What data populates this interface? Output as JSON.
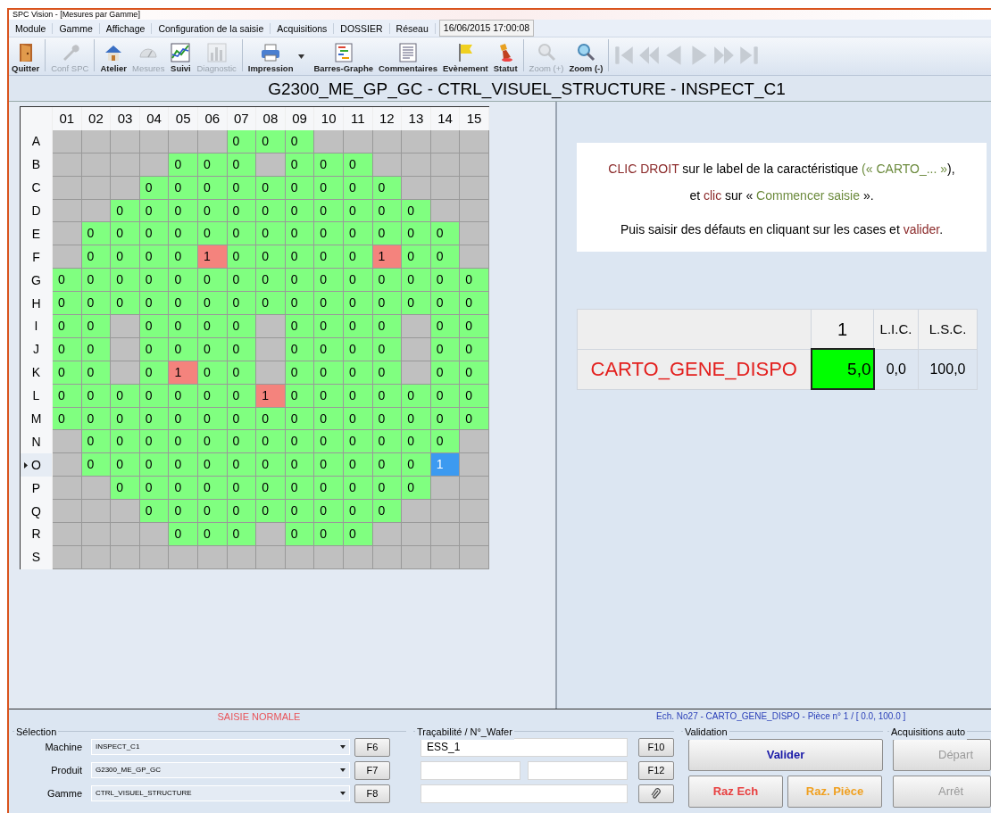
{
  "window": {
    "title": "SPC Vision - [Mesures par Gamme]"
  },
  "menu": {
    "items": [
      "Module",
      "Gamme",
      "Affichage",
      "Configuration de la saisie",
      "Acquisitions",
      "DOSSIER",
      "Réseau"
    ],
    "datetime": "16/06/2015 17:00:08"
  },
  "toolbar": {
    "buttons": [
      {
        "kind": "exit",
        "label": "Quitter",
        "disabled": false,
        "has_menu": false
      },
      {
        "kind": "settings",
        "label": "Conf SPC",
        "disabled": true,
        "has_menu": false
      },
      {
        "kind": "workshop",
        "label": "Atelier",
        "disabled": false,
        "has_menu": false
      },
      {
        "kind": "gauge",
        "label": "Mesures",
        "disabled": true,
        "has_menu": false
      },
      {
        "kind": "trend",
        "label": "Suivi",
        "disabled": false,
        "has_menu": false
      },
      {
        "kind": "histogram",
        "label": "Diagnostic",
        "disabled": true,
        "has_menu": false
      },
      {
        "kind": "print",
        "label": "Impression",
        "disabled": false,
        "has_menu": true
      },
      {
        "kind": "gantt",
        "label": "Barres-Graphe",
        "disabled": false,
        "has_menu": false
      },
      {
        "kind": "notes",
        "label": "Commentaires",
        "disabled": false,
        "has_menu": false
      },
      {
        "kind": "flag",
        "label": "Evènement",
        "disabled": false,
        "has_menu": false
      },
      {
        "kind": "stamp",
        "label": "Statut",
        "disabled": false,
        "has_menu": false
      },
      {
        "kind": "zoom_in",
        "label": "Zoom (+)",
        "disabled": true,
        "has_menu": false
      },
      {
        "kind": "zoom_out",
        "label": "Zoom (-)",
        "disabled": false,
        "has_menu": false
      }
    ],
    "nav": [
      {
        "kind": "first",
        "disabled": true
      },
      {
        "kind": "fast_back",
        "disabled": true
      },
      {
        "kind": "back",
        "disabled": true
      },
      {
        "kind": "forward",
        "disabled": true
      },
      {
        "kind": "fast_forward",
        "disabled": true
      },
      {
        "kind": "last",
        "disabled": true
      }
    ]
  },
  "header": {
    "title": "G2300_ME_GP_GC - CTRL_VISUEL_STRUCTURE - INSPECT_C1"
  },
  "wafer_map": {
    "columns": [
      "01",
      "02",
      "03",
      "04",
      "05",
      "06",
      "07",
      "08",
      "09",
      "10",
      "11",
      "12",
      "13",
      "14",
      "15"
    ],
    "rows": [
      {
        "label": "A",
        "current": false,
        "cells": [
          {
            "kind": "blank",
            "selected": false
          },
          {
            "kind": "blank",
            "selected": false
          },
          {
            "kind": "blank",
            "selected": false
          },
          {
            "kind": "blank",
            "selected": false
          },
          {
            "kind": "blank",
            "selected": false
          },
          {
            "kind": "blank",
            "selected": false
          },
          {
            "value": "0",
            "kind": "pass",
            "selected": false
          },
          {
            "value": "0",
            "kind": "pass",
            "selected": false
          },
          {
            "value": "0",
            "kind": "pass",
            "selected": false
          },
          {
            "kind": "blank",
            "selected": false
          },
          {
            "kind": "blank",
            "selected": false
          },
          {
            "kind": "blank",
            "selected": false
          },
          {
            "kind": "blank",
            "selected": false
          },
          {
            "kind": "blank",
            "selected": false
          },
          {
            "kind": "blank",
            "selected": false
          }
        ]
      },
      {
        "label": "B",
        "current": false,
        "cells": [
          {
            "kind": "blank",
            "selected": false
          },
          {
            "kind": "blank",
            "selected": false
          },
          {
            "kind": "blank",
            "selected": false
          },
          {
            "kind": "blank",
            "selected": false
          },
          {
            "value": "0",
            "kind": "pass",
            "selected": false
          },
          {
            "value": "0",
            "kind": "pass",
            "selected": false
          },
          {
            "value": "0",
            "kind": "pass",
            "selected": false
          },
          {
            "kind": "blank",
            "selected": false
          },
          {
            "value": "0",
            "kind": "pass",
            "selected": false
          },
          {
            "value": "0",
            "kind": "pass",
            "selected": false
          },
          {
            "value": "0",
            "kind": "pass",
            "selected": false
          },
          {
            "kind": "blank",
            "selected": false
          },
          {
            "kind": "blank",
            "selected": false
          },
          {
            "kind": "blank",
            "selected": false
          },
          {
            "kind": "blank",
            "selected": false
          }
        ]
      },
      {
        "label": "C",
        "current": false,
        "cells": [
          {
            "kind": "blank",
            "selected": false
          },
          {
            "kind": "blank",
            "selected": false
          },
          {
            "kind": "blank",
            "selected": false
          },
          {
            "value": "0",
            "kind": "pass",
            "selected": false
          },
          {
            "value": "0",
            "kind": "pass",
            "selected": false
          },
          {
            "value": "0",
            "kind": "pass",
            "selected": false
          },
          {
            "value": "0",
            "kind": "pass",
            "selected": false
          },
          {
            "value": "0",
            "kind": "pass",
            "selected": false
          },
          {
            "value": "0",
            "kind": "pass",
            "selected": false
          },
          {
            "value": "0",
            "kind": "pass",
            "selected": false
          },
          {
            "value": "0",
            "kind": "pass",
            "selected": false
          },
          {
            "value": "0",
            "kind": "pass",
            "selected": false
          },
          {
            "kind": "blank",
            "selected": false
          },
          {
            "kind": "blank",
            "selected": false
          },
          {
            "kind": "blank",
            "selected": false
          }
        ]
      },
      {
        "label": "D",
        "current": false,
        "cells": [
          {
            "kind": "blank",
            "selected": false
          },
          {
            "kind": "blank",
            "selected": false
          },
          {
            "value": "0",
            "kind": "pass",
            "selected": false
          },
          {
            "value": "0",
            "kind": "pass",
            "selected": false
          },
          {
            "value": "0",
            "kind": "pass",
            "selected": false
          },
          {
            "value": "0",
            "kind": "pass",
            "selected": false
          },
          {
            "value": "0",
            "kind": "pass",
            "selected": false
          },
          {
            "value": "0",
            "kind": "pass",
            "selected": false
          },
          {
            "value": "0",
            "kind": "pass",
            "selected": false
          },
          {
            "value": "0",
            "kind": "pass",
            "selected": false
          },
          {
            "value": "0",
            "kind": "pass",
            "selected": false
          },
          {
            "value": "0",
            "kind": "pass",
            "selected": false
          },
          {
            "value": "0",
            "kind": "pass",
            "selected": false
          },
          {
            "kind": "blank",
            "selected": false
          },
          {
            "kind": "blank",
            "selected": false
          }
        ]
      },
      {
        "label": "E",
        "current": false,
        "cells": [
          {
            "kind": "blank",
            "selected": false
          },
          {
            "value": "0",
            "kind": "pass",
            "selected": false
          },
          {
            "value": "0",
            "kind": "pass",
            "selected": false
          },
          {
            "value": "0",
            "kind": "pass",
            "selected": false
          },
          {
            "value": "0",
            "kind": "pass",
            "selected": false
          },
          {
            "value": "0",
            "kind": "pass",
            "selected": false
          },
          {
            "value": "0",
            "kind": "pass",
            "selected": false
          },
          {
            "value": "0",
            "kind": "pass",
            "selected": false
          },
          {
            "value": "0",
            "kind": "pass",
            "selected": false
          },
          {
            "value": "0",
            "kind": "pass",
            "selected": false
          },
          {
            "value": "0",
            "kind": "pass",
            "selected": false
          },
          {
            "value": "0",
            "kind": "pass",
            "selected": false
          },
          {
            "value": "0",
            "kind": "pass",
            "selected": false
          },
          {
            "value": "0",
            "kind": "pass",
            "selected": false
          },
          {
            "kind": "blank",
            "selected": false
          }
        ]
      },
      {
        "label": "F",
        "current": false,
        "cells": [
          {
            "kind": "blank",
            "selected": false
          },
          {
            "value": "0",
            "kind": "pass",
            "selected": false
          },
          {
            "value": "0",
            "kind": "pass",
            "selected": false
          },
          {
            "value": "0",
            "kind": "pass",
            "selected": false
          },
          {
            "value": "0",
            "kind": "pass",
            "selected": false
          },
          {
            "value": "1",
            "kind": "fail",
            "selected": false
          },
          {
            "value": "0",
            "kind": "pass",
            "selected": false
          },
          {
            "value": "0",
            "kind": "pass",
            "selected": false
          },
          {
            "value": "0",
            "kind": "pass",
            "selected": false
          },
          {
            "value": "0",
            "kind": "pass",
            "selected": false
          },
          {
            "value": "0",
            "kind": "pass",
            "selected": false
          },
          {
            "value": "1",
            "kind": "fail",
            "selected": false
          },
          {
            "value": "0",
            "kind": "pass",
            "selected": false
          },
          {
            "value": "0",
            "kind": "pass",
            "selected": false
          },
          {
            "kind": "blank",
            "selected": false
          }
        ]
      },
      {
        "label": "G",
        "current": false,
        "cells": [
          {
            "value": "0",
            "kind": "pass",
            "selected": false
          },
          {
            "value": "0",
            "kind": "pass",
            "selected": false
          },
          {
            "value": "0",
            "kind": "pass",
            "selected": false
          },
          {
            "value": "0",
            "kind": "pass",
            "selected": false
          },
          {
            "value": "0",
            "kind": "pass",
            "selected": false
          },
          {
            "value": "0",
            "kind": "pass",
            "selected": false
          },
          {
            "value": "0",
            "kind": "pass",
            "selected": false
          },
          {
            "value": "0",
            "kind": "pass",
            "selected": false
          },
          {
            "value": "0",
            "kind": "pass",
            "selected": false
          },
          {
            "value": "0",
            "kind": "pass",
            "selected": false
          },
          {
            "value": "0",
            "kind": "pass",
            "selected": false
          },
          {
            "value": "0",
            "kind": "pass",
            "selected": false
          },
          {
            "value": "0",
            "kind": "pass",
            "selected": false
          },
          {
            "value": "0",
            "kind": "pass",
            "selected": false
          },
          {
            "value": "0",
            "kind": "pass",
            "selected": false
          }
        ]
      },
      {
        "label": "H",
        "current": false,
        "cells": [
          {
            "value": "0",
            "kind": "pass",
            "selected": false
          },
          {
            "value": "0",
            "kind": "pass",
            "selected": false
          },
          {
            "value": "0",
            "kind": "pass",
            "selected": false
          },
          {
            "value": "0",
            "kind": "pass",
            "selected": false
          },
          {
            "value": "0",
            "kind": "pass",
            "selected": false
          },
          {
            "value": "0",
            "kind": "pass",
            "selected": false
          },
          {
            "value": "0",
            "kind": "pass",
            "selected": false
          },
          {
            "value": "0",
            "kind": "pass",
            "selected": false
          },
          {
            "value": "0",
            "kind": "pass",
            "selected": false
          },
          {
            "value": "0",
            "kind": "pass",
            "selected": false
          },
          {
            "value": "0",
            "kind": "pass",
            "selected": false
          },
          {
            "value": "0",
            "kind": "pass",
            "selected": false
          },
          {
            "value": "0",
            "kind": "pass",
            "selected": false
          },
          {
            "value": "0",
            "kind": "pass",
            "selected": false
          },
          {
            "value": "0",
            "kind": "pass",
            "selected": false
          }
        ]
      },
      {
        "label": "I",
        "current": false,
        "cells": [
          {
            "value": "0",
            "kind": "pass",
            "selected": false
          },
          {
            "value": "0",
            "kind": "pass",
            "selected": false
          },
          {
            "kind": "blank",
            "selected": false
          },
          {
            "value": "0",
            "kind": "pass",
            "selected": false
          },
          {
            "value": "0",
            "kind": "pass",
            "selected": false
          },
          {
            "value": "0",
            "kind": "pass",
            "selected": false
          },
          {
            "value": "0",
            "kind": "pass",
            "selected": false
          },
          {
            "kind": "blank",
            "selected": false
          },
          {
            "value": "0",
            "kind": "pass",
            "selected": false
          },
          {
            "value": "0",
            "kind": "pass",
            "selected": false
          },
          {
            "value": "0",
            "kind": "pass",
            "selected": false
          },
          {
            "value": "0",
            "kind": "pass",
            "selected": false
          },
          {
            "kind": "blank",
            "selected": false
          },
          {
            "value": "0",
            "kind": "pass",
            "selected": false
          },
          {
            "value": "0",
            "kind": "pass",
            "selected": false
          }
        ]
      },
      {
        "label": "J",
        "current": false,
        "cells": [
          {
            "value": "0",
            "kind": "pass",
            "selected": false
          },
          {
            "value": "0",
            "kind": "pass",
            "selected": false
          },
          {
            "kind": "blank",
            "selected": false
          },
          {
            "value": "0",
            "kind": "pass",
            "selected": false
          },
          {
            "value": "0",
            "kind": "pass",
            "selected": false
          },
          {
            "value": "0",
            "kind": "pass",
            "selected": false
          },
          {
            "value": "0",
            "kind": "pass",
            "selected": false
          },
          {
            "kind": "blank",
            "selected": false
          },
          {
            "value": "0",
            "kind": "pass",
            "selected": false
          },
          {
            "value": "0",
            "kind": "pass",
            "selected": false
          },
          {
            "value": "0",
            "kind": "pass",
            "selected": false
          },
          {
            "value": "0",
            "kind": "pass",
            "selected": false
          },
          {
            "kind": "blank",
            "selected": false
          },
          {
            "value": "0",
            "kind": "pass",
            "selected": false
          },
          {
            "value": "0",
            "kind": "pass",
            "selected": false
          }
        ]
      },
      {
        "label": "K",
        "current": false,
        "cells": [
          {
            "value": "0",
            "kind": "pass",
            "selected": false
          },
          {
            "value": "0",
            "kind": "pass",
            "selected": false
          },
          {
            "kind": "blank",
            "selected": false
          },
          {
            "value": "0",
            "kind": "pass",
            "selected": false
          },
          {
            "value": "1",
            "kind": "fail",
            "selected": false
          },
          {
            "value": "0",
            "kind": "pass",
            "selected": false
          },
          {
            "value": "0",
            "kind": "pass",
            "selected": false
          },
          {
            "kind": "blank",
            "selected": false
          },
          {
            "value": "0",
            "kind": "pass",
            "selected": false
          },
          {
            "value": "0",
            "kind": "pass",
            "selected": false
          },
          {
            "value": "0",
            "kind": "pass",
            "selected": false
          },
          {
            "value": "0",
            "kind": "pass",
            "selected": false
          },
          {
            "kind": "blank",
            "selected": false
          },
          {
            "value": "0",
            "kind": "pass",
            "selected": false
          },
          {
            "value": "0",
            "kind": "pass",
            "selected": false
          }
        ]
      },
      {
        "label": "L",
        "current": false,
        "cells": [
          {
            "value": "0",
            "kind": "pass",
            "selected": false
          },
          {
            "value": "0",
            "kind": "pass",
            "selected": false
          },
          {
            "value": "0",
            "kind": "pass",
            "selected": false
          },
          {
            "value": "0",
            "kind": "pass",
            "selected": false
          },
          {
            "value": "0",
            "kind": "pass",
            "selected": false
          },
          {
            "value": "0",
            "kind": "pass",
            "selected": false
          },
          {
            "value": "0",
            "kind": "pass",
            "selected": false
          },
          {
            "value": "1",
            "kind": "fail",
            "selected": false
          },
          {
            "value": "0",
            "kind": "pass",
            "selected": false
          },
          {
            "value": "0",
            "kind": "pass",
            "selected": false
          },
          {
            "value": "0",
            "kind": "pass",
            "selected": false
          },
          {
            "value": "0",
            "kind": "pass",
            "selected": false
          },
          {
            "value": "0",
            "kind": "pass",
            "selected": false
          },
          {
            "value": "0",
            "kind": "pass",
            "selected": false
          },
          {
            "value": "0",
            "kind": "pass",
            "selected": false
          }
        ]
      },
      {
        "label": "M",
        "current": false,
        "cells": [
          {
            "value": "0",
            "kind": "pass",
            "selected": false
          },
          {
            "value": "0",
            "kind": "pass",
            "selected": false
          },
          {
            "value": "0",
            "kind": "pass",
            "selected": false
          },
          {
            "value": "0",
            "kind": "pass",
            "selected": false
          },
          {
            "value": "0",
            "kind": "pass",
            "selected": false
          },
          {
            "value": "0",
            "kind": "pass",
            "selected": false
          },
          {
            "value": "0",
            "kind": "pass",
            "selected": false
          },
          {
            "value": "0",
            "kind": "pass",
            "selected": false
          },
          {
            "value": "0",
            "kind": "pass",
            "selected": false
          },
          {
            "value": "0",
            "kind": "pass",
            "selected": false
          },
          {
            "value": "0",
            "kind": "pass",
            "selected": false
          },
          {
            "value": "0",
            "kind": "pass",
            "selected": false
          },
          {
            "value": "0",
            "kind": "pass",
            "selected": false
          },
          {
            "value": "0",
            "kind": "pass",
            "selected": false
          },
          {
            "value": "0",
            "kind": "pass",
            "selected": false
          }
        ]
      },
      {
        "label": "N",
        "current": false,
        "cells": [
          {
            "kind": "blank",
            "selected": false
          },
          {
            "value": "0",
            "kind": "pass",
            "selected": false
          },
          {
            "value": "0",
            "kind": "pass",
            "selected": false
          },
          {
            "value": "0",
            "kind": "pass",
            "selected": false
          },
          {
            "value": "0",
            "kind": "pass",
            "selected": false
          },
          {
            "value": "0",
            "kind": "pass",
            "selected": false
          },
          {
            "value": "0",
            "kind": "pass",
            "selected": false
          },
          {
            "value": "0",
            "kind": "pass",
            "selected": false
          },
          {
            "value": "0",
            "kind": "pass",
            "selected": false
          },
          {
            "value": "0",
            "kind": "pass",
            "selected": false
          },
          {
            "value": "0",
            "kind": "pass",
            "selected": false
          },
          {
            "value": "0",
            "kind": "pass",
            "selected": false
          },
          {
            "value": "0",
            "kind": "pass",
            "selected": false
          },
          {
            "value": "0",
            "kind": "pass",
            "selected": false
          },
          {
            "kind": "blank",
            "selected": false
          }
        ]
      },
      {
        "label": "O",
        "current": true,
        "cells": [
          {
            "kind": "blank",
            "selected": false
          },
          {
            "value": "0",
            "kind": "pass",
            "selected": false
          },
          {
            "value": "0",
            "kind": "pass",
            "selected": false
          },
          {
            "value": "0",
            "kind": "pass",
            "selected": false
          },
          {
            "value": "0",
            "kind": "pass",
            "selected": false
          },
          {
            "value": "0",
            "kind": "pass",
            "selected": false
          },
          {
            "value": "0",
            "kind": "pass",
            "selected": false
          },
          {
            "value": "0",
            "kind": "pass",
            "selected": false
          },
          {
            "value": "0",
            "kind": "pass",
            "selected": false
          },
          {
            "value": "0",
            "kind": "pass",
            "selected": false
          },
          {
            "value": "0",
            "kind": "pass",
            "selected": false
          },
          {
            "value": "0",
            "kind": "pass",
            "selected": false
          },
          {
            "value": "0",
            "kind": "pass",
            "selected": false
          },
          {
            "value": "1",
            "kind": "fail",
            "selected": true
          },
          {
            "kind": "blank",
            "selected": false
          }
        ]
      },
      {
        "label": "P",
        "current": false,
        "cells": [
          {
            "kind": "blank",
            "selected": false
          },
          {
            "kind": "blank",
            "selected": false
          },
          {
            "value": "0",
            "kind": "pass",
            "selected": false
          },
          {
            "value": "0",
            "kind": "pass",
            "selected": false
          },
          {
            "value": "0",
            "kind": "pass",
            "selected": false
          },
          {
            "value": "0",
            "kind": "pass",
            "selected": false
          },
          {
            "value": "0",
            "kind": "pass",
            "selected": false
          },
          {
            "value": "0",
            "kind": "pass",
            "selected": false
          },
          {
            "value": "0",
            "kind": "pass",
            "selected": false
          },
          {
            "value": "0",
            "kind": "pass",
            "selected": false
          },
          {
            "value": "0",
            "kind": "pass",
            "selected": false
          },
          {
            "value": "0",
            "kind": "pass",
            "selected": false
          },
          {
            "value": "0",
            "kind": "pass",
            "selected": false
          },
          {
            "kind": "blank",
            "selected": false
          },
          {
            "kind": "blank",
            "selected": false
          }
        ]
      },
      {
        "label": "Q",
        "current": false,
        "cells": [
          {
            "kind": "blank",
            "selected": false
          },
          {
            "kind": "blank",
            "selected": false
          },
          {
            "kind": "blank",
            "selected": false
          },
          {
            "value": "0",
            "kind": "pass",
            "selected": false
          },
          {
            "value": "0",
            "kind": "pass",
            "selected": false
          },
          {
            "value": "0",
            "kind": "pass",
            "selected": false
          },
          {
            "value": "0",
            "kind": "pass",
            "selected": false
          },
          {
            "value": "0",
            "kind": "pass",
            "selected": false
          },
          {
            "value": "0",
            "kind": "pass",
            "selected": false
          },
          {
            "value": "0",
            "kind": "pass",
            "selected": false
          },
          {
            "value": "0",
            "kind": "pass",
            "selected": false
          },
          {
            "value": "0",
            "kind": "pass",
            "selected": false
          },
          {
            "kind": "blank",
            "selected": false
          },
          {
            "kind": "blank",
            "selected": false
          },
          {
            "kind": "blank",
            "selected": false
          }
        ]
      },
      {
        "label": "R",
        "current": false,
        "cells": [
          {
            "kind": "blank",
            "selected": false
          },
          {
            "kind": "blank",
            "selected": false
          },
          {
            "kind": "blank",
            "selected": false
          },
          {
            "kind": "blank",
            "selected": false
          },
          {
            "value": "0",
            "kind": "pass",
            "selected": false
          },
          {
            "value": "0",
            "kind": "pass",
            "selected": false
          },
          {
            "value": "0",
            "kind": "pass",
            "selected": false
          },
          {
            "kind": "blank",
            "selected": false
          },
          {
            "value": "0",
            "kind": "pass",
            "selected": false
          },
          {
            "value": "0",
            "kind": "pass",
            "selected": false
          },
          {
            "value": "0",
            "kind": "pass",
            "selected": false
          },
          {
            "kind": "blank",
            "selected": false
          },
          {
            "kind": "blank",
            "selected": false
          },
          {
            "kind": "blank",
            "selected": false
          },
          {
            "kind": "blank",
            "selected": false
          }
        ]
      },
      {
        "label": "S",
        "current": false,
        "cells": [
          {
            "kind": "blank",
            "selected": false
          },
          {
            "kind": "blank",
            "selected": false
          },
          {
            "kind": "blank",
            "selected": false
          },
          {
            "kind": "blank",
            "selected": false
          },
          {
            "kind": "blank",
            "selected": false
          },
          {
            "kind": "blank",
            "selected": false
          },
          {
            "kind": "blank",
            "selected": false
          },
          {
            "kind": "blank",
            "selected": false
          },
          {
            "kind": "blank",
            "selected": false
          },
          {
            "kind": "blank",
            "selected": false
          },
          {
            "kind": "blank",
            "selected": false
          },
          {
            "kind": "blank",
            "selected": false
          },
          {
            "kind": "blank",
            "selected": false
          },
          {
            "kind": "blank",
            "selected": false
          },
          {
            "kind": "blank",
            "selected": false
          }
        ]
      }
    ]
  },
  "instructions": [
    {
      "segments": [
        {
          "text": "CLIC DROIT",
          "kind": "action"
        },
        {
          "text": " sur le label de la caractéristique ",
          "kind": "plain"
        },
        {
          "text": "(« CARTO_... »",
          "kind": "term"
        },
        {
          "text": "),",
          "kind": "plain"
        }
      ]
    },
    {
      "segments": [
        {
          "text": "et ",
          "kind": "plain"
        },
        {
          "text": "clic",
          "kind": "action"
        },
        {
          "text": " sur « ",
          "kind": "plain"
        },
        {
          "text": "Commencer saisie",
          "kind": "term"
        },
        {
          "text": " ».",
          "kind": "plain"
        }
      ]
    },
    {
      "segments": [
        {
          "text": "Puis saisir des défauts en cliquant sur les cases et ",
          "kind": "plain"
        },
        {
          "text": "valider",
          "kind": "action"
        },
        {
          "text": ".",
          "kind": "plain"
        }
      ]
    }
  ],
  "characteristics": {
    "columns": [
      "1",
      "L.I.C.",
      "L.S.C."
    ],
    "rows": [
      {
        "name": "CARTO_GENE_DISPO",
        "value": "5,0",
        "in_tolerance": true,
        "lic": "0,0",
        "lsc": "100,0"
      }
    ]
  },
  "bottom": {
    "mode": "SAISIE NORMALE",
    "sample_info": "Ech. No27 - CARTO_GENE_DISPO - Pièce n° 1 / [ 0.0, 100.0 ]",
    "selection": {
      "title": "Sélection",
      "rows": [
        {
          "label": "Machine",
          "value": "INSPECT_C1",
          "key": "F6"
        },
        {
          "label": "Produit",
          "value": "G2300_ME_GP_GC",
          "key": "F7"
        },
        {
          "label": "Gamme",
          "value": "CTRL_VISUEL_STRUCTURE",
          "key": "F8"
        }
      ]
    },
    "traceability": {
      "title": "Traçabilité / N°_Wafer",
      "wafer": "ESS_1",
      "key1": "F10",
      "key2": "F12"
    },
    "validation": {
      "title": "Validation",
      "buttons": [
        {
          "kind": "primary",
          "label": "Valider"
        },
        {
          "kind": "danger",
          "label": "Raz Ech"
        },
        {
          "kind": "warning",
          "label": "Raz. Pièce"
        }
      ]
    },
    "auto": {
      "title": "Acquisitions auto",
      "buttons": [
        {
          "label": "Départ",
          "disabled": true
        },
        {
          "label": "Arrêt",
          "disabled": true
        }
      ]
    }
  }
}
